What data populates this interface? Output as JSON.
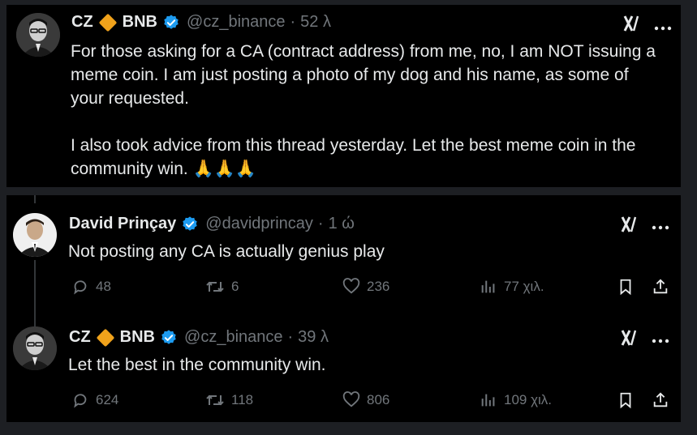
{
  "colors": {
    "background": "#000000",
    "frame": "#1d1f23",
    "text": "#e7e9ea",
    "muted": "#71767b",
    "verified": "#1d9bf0",
    "binance": "#f0a21b"
  },
  "tweets": [
    {
      "author_name": "CZ",
      "org_label": "BNB",
      "handle": "@cz_binance",
      "time": "52 λ",
      "text_lines": [
        "For those asking for a CA (contract address) from me, no, I am NOT issuing a",
        "meme coin. I am just posting a photo of my dog and his name, as some of",
        "your requested.",
        "",
        "I also took advice from this thread yesterday. Let the best meme coin in the",
        "community win. 🙏🙏🙏"
      ],
      "grok_icon": "grok-icon",
      "more_icon": "more-icon"
    },
    {
      "author_name": "David Prinçay",
      "handle": "@davidprincay",
      "time": "1 ώ",
      "text": "Not posting any CA is actually genius play",
      "replies": "48",
      "reposts": "6",
      "likes": "236",
      "views": "77 χιλ."
    },
    {
      "author_name": "CZ",
      "org_label": "BNB",
      "handle": "@cz_binance",
      "time": "39 λ",
      "text": "Let the best in the community win.",
      "replies": "624",
      "reposts": "118",
      "likes": "806",
      "views": "109 χιλ."
    }
  ]
}
